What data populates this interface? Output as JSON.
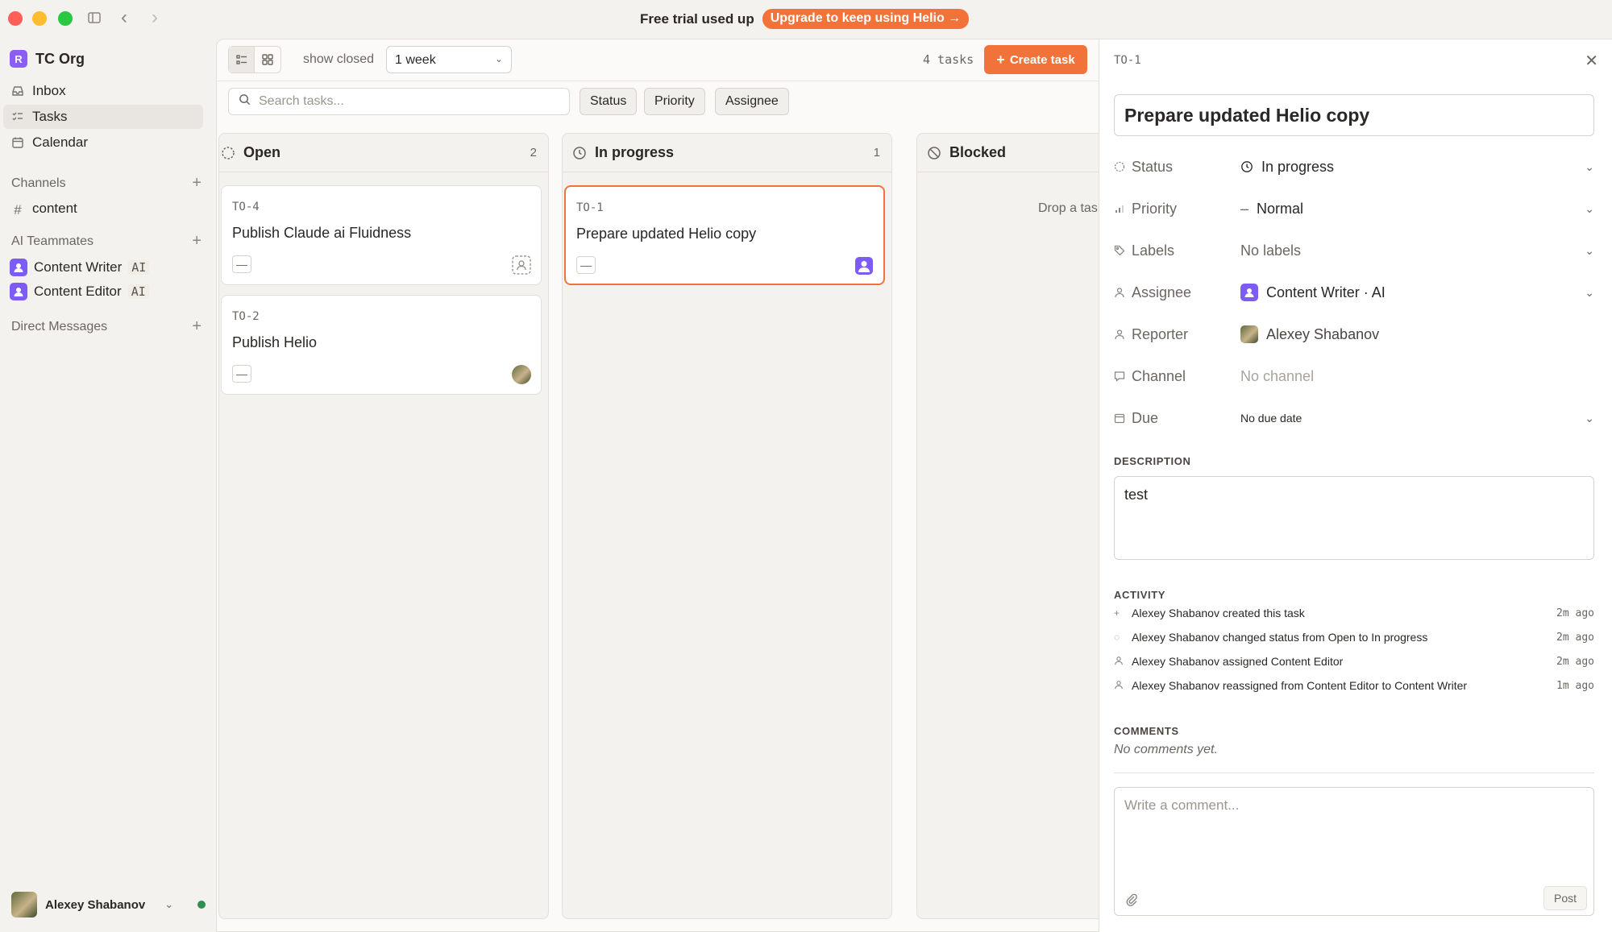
{
  "topbar": {
    "trial_text": "Free trial used up",
    "upgrade_label": "Upgrade to keep using Helio →"
  },
  "sidebar": {
    "org_initial": "R",
    "org_name": "TC Org",
    "nav": [
      {
        "label": "Inbox",
        "icon": "inbox-icon"
      },
      {
        "label": "Tasks",
        "icon": "tasks-icon",
        "active": true
      },
      {
        "label": "Calendar",
        "icon": "calendar-icon"
      }
    ],
    "channels_heading": "Channels",
    "channels": [
      {
        "label": "content"
      }
    ],
    "teammates_heading": "AI Teammates",
    "teammates": [
      {
        "name": "Content Writer",
        "tag": "AI"
      },
      {
        "name": "Content Editor",
        "tag": "AI"
      }
    ],
    "dm_heading": "Direct Messages",
    "user_name": "Alexey Shabanov"
  },
  "toolbar": {
    "show_closed": "show closed",
    "period": "1 week",
    "task_count": "4 tasks",
    "create_label": "Create task",
    "search_placeholder": "Search tasks...",
    "filters": [
      "Status",
      "Priority",
      "Assignee"
    ]
  },
  "board": {
    "columns": [
      {
        "title": "Open",
        "count": "2"
      },
      {
        "title": "In progress",
        "count": "1"
      },
      {
        "title": "Blocked",
        "count": "",
        "drop_hint": "Drop a tas"
      }
    ],
    "cards": [
      {
        "key": "TO-4",
        "title": "Publish Claude ai Fluidness",
        "priority_glyph": "—"
      },
      {
        "key": "TO-2",
        "title": "Publish Helio",
        "priority_glyph": "—"
      },
      {
        "key": "TO-1",
        "title": "Prepare updated Helio copy",
        "priority_glyph": "—"
      }
    ]
  },
  "detail": {
    "key": "TO-1",
    "title": "Prepare updated Helio copy",
    "fields": {
      "status_label": "Status",
      "status_value": "In progress",
      "priority_label": "Priority",
      "priority_value": "Normal",
      "labels_label": "Labels",
      "labels_value": "No labels",
      "assignee_label": "Assignee",
      "assignee_value": "Content Writer · AI",
      "reporter_label": "Reporter",
      "reporter_value": "Alexey Shabanov",
      "channel_label": "Channel",
      "channel_value": "No channel",
      "due_label": "Due",
      "due_value": "No due date"
    },
    "description_heading": "DESCRIPTION",
    "description": "test",
    "activity_heading": "ACTIVITY",
    "activity": [
      {
        "icon": "plus-icon",
        "text": "Alexey Shabanov created this task",
        "time": "2m ago"
      },
      {
        "icon": "status-icon",
        "text": "Alexey Shabanov changed status from Open to In progress",
        "time": "2m ago"
      },
      {
        "icon": "person-icon",
        "text": "Alexey Shabanov assigned Content Editor",
        "time": "2m ago"
      },
      {
        "icon": "person-icon",
        "text": "Alexey Shabanov reassigned from Content Editor to Content Writer",
        "time": "1m ago"
      }
    ],
    "comments_heading": "COMMENTS",
    "no_comments": "No comments yet.",
    "comment_placeholder": "Write a comment...",
    "post_label": "Post"
  },
  "colors": {
    "accent": "#f2733a",
    "ai_avatar": "#7c5cf4",
    "online": "#2f8f4e"
  }
}
